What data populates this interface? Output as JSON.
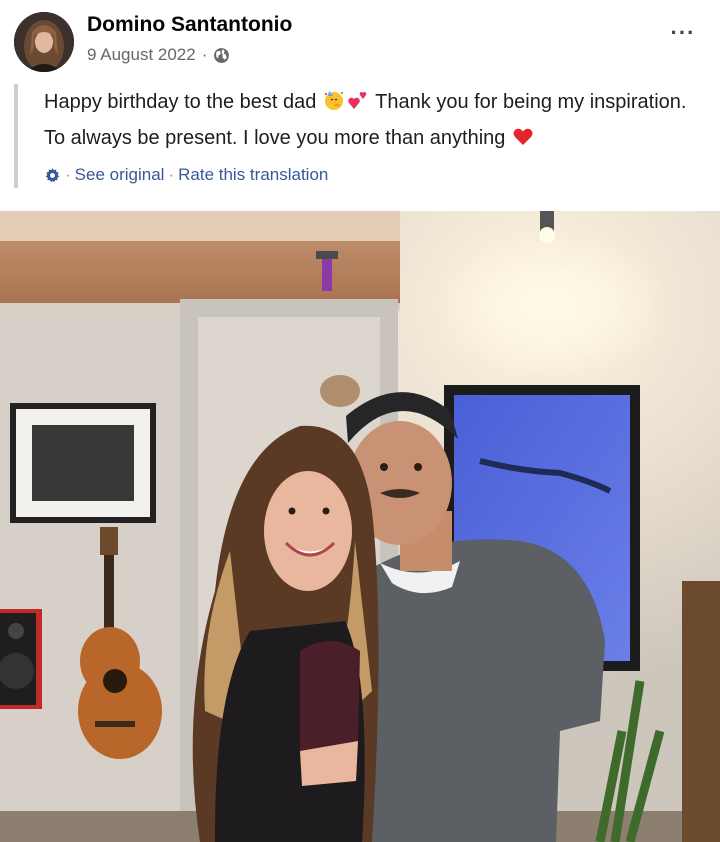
{
  "post": {
    "author": "Domino Santantonio",
    "date": "9 August 2022",
    "meta_separator": "·",
    "audience_icon": "globe-icon",
    "more_label": "···",
    "message_part1": "Happy birthday to the best dad",
    "message_part2": " Thank you for being my inspiration. To always be present. I love you more than anything",
    "emojis": [
      "party-face-emoji",
      "two-hearts-emoji",
      "red-heart-emoji"
    ],
    "translation": {
      "settings_icon": "gear-icon",
      "separator": "·",
      "see_original": "See original",
      "rate_translation": "Rate this translation"
    },
    "photo": {
      "subject": "photo-father-daughter"
    }
  },
  "colors": {
    "link": "#385898",
    "meta": "#65676b",
    "quote_bar": "#ccd0d5"
  }
}
